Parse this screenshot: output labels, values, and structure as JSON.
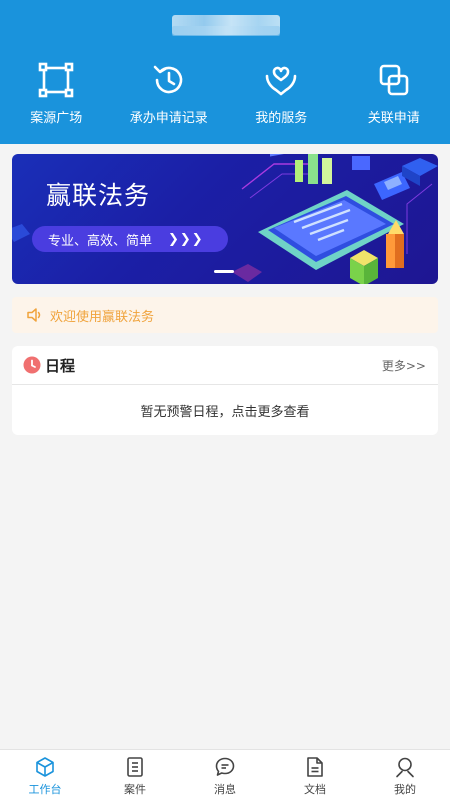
{
  "header": {
    "quick_actions": [
      {
        "label": "案源广场",
        "icon": "crop-frame-icon"
      },
      {
        "label": "承办申请记录",
        "icon": "history-clock-icon"
      },
      {
        "label": "我的服务",
        "icon": "heart-hands-icon"
      },
      {
        "label": "关联申请",
        "icon": "copy-link-icon"
      }
    ]
  },
  "banner": {
    "title": "赢联法务",
    "slogan": "专业、高效、简单",
    "arrows": "❯❯❯"
  },
  "notice": {
    "text": "欢迎使用赢联法务",
    "color": "#f0a33c"
  },
  "schedule": {
    "title": "日程",
    "more": "更多>>",
    "empty_text": "暂无预警日程，点击更多查看"
  },
  "tabbar": {
    "tabs": [
      {
        "label": "工作台",
        "icon": "cube-icon"
      },
      {
        "label": "案件",
        "icon": "document-list-icon"
      },
      {
        "label": "消息",
        "icon": "chat-bubble-icon"
      },
      {
        "label": "文档",
        "icon": "file-icon"
      },
      {
        "label": "我的",
        "icon": "user-icon"
      }
    ],
    "active_color": "#1a93dc"
  },
  "colors": {
    "brand": "#1a93dc",
    "background": "#f4f4f4"
  }
}
